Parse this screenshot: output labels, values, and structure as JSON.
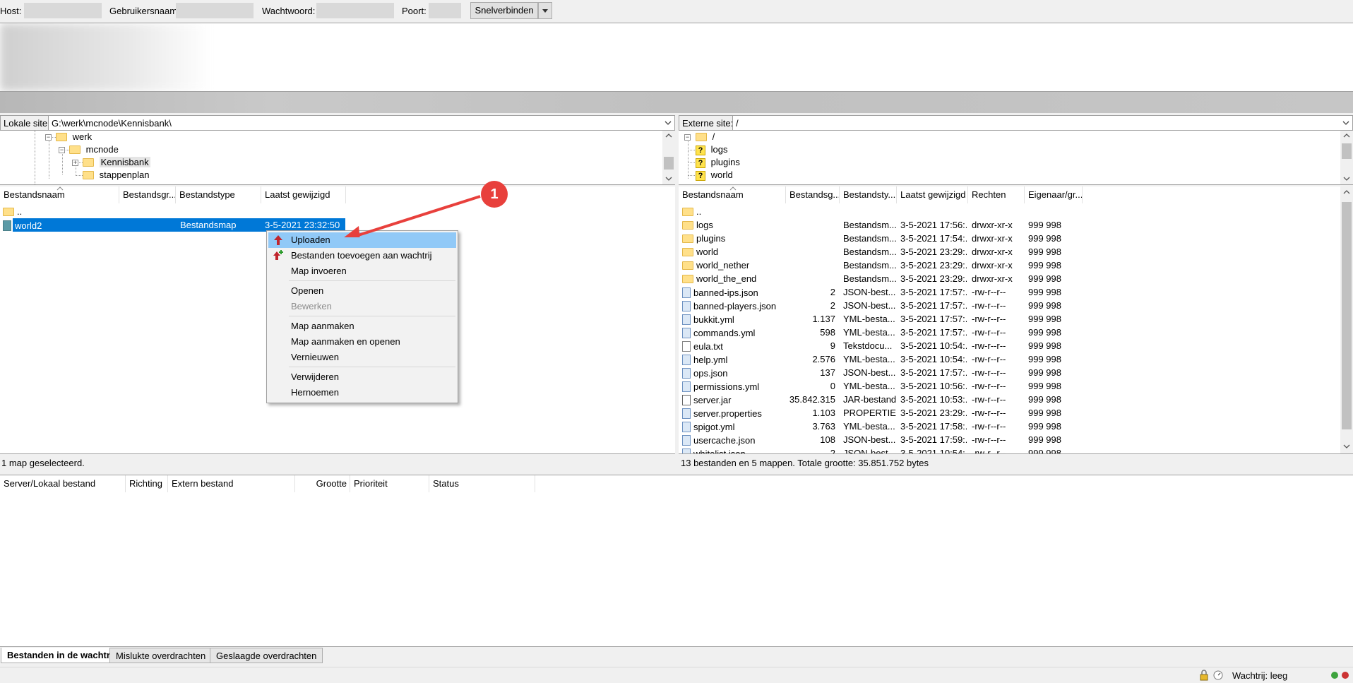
{
  "quickconnect": {
    "host_label": "Host:",
    "user_label": "Gebruikersnaam:",
    "pass_label": "Wachtwoord:",
    "port_label": "Poort:",
    "connect_button": "Snelverbinden",
    "dropdown_icon": "chevron-down-icon"
  },
  "local": {
    "site_label": "Lokale site:",
    "path": "G:\\werk\\mcnode\\Kennisbank\\",
    "tree": [
      "werk",
      "mcnode",
      "Kennisbank",
      "stappenplan"
    ],
    "columns": [
      "Bestandsnaam",
      "Bestandsgr...",
      "Bestandstype",
      "Laatst gewijzigd"
    ],
    "files": [
      {
        "name": "..",
        "type": "",
        "modified": ""
      },
      {
        "name": "world2",
        "type": "Bestandsmap",
        "modified": "3-5-2021 23:32:50"
      }
    ],
    "status": "1 map geselecteerd."
  },
  "remote": {
    "site_label": "Externe site:",
    "path": "/",
    "tree": [
      "/",
      "logs",
      "plugins",
      "world"
    ],
    "tree_badge": "?",
    "columns": [
      "Bestandsnaam",
      "Bestandsg...",
      "Bestandsty...",
      "Laatst gewijzigd",
      "Rechten",
      "Eigenaar/gr..."
    ],
    "files": [
      {
        "name": "..",
        "size": "",
        "type": "",
        "modified": "",
        "perms": "",
        "owner": "",
        "icon": "folder"
      },
      {
        "name": "logs",
        "size": "",
        "type": "Bestandsm...",
        "modified": "3-5-2021 17:56:...",
        "perms": "drwxr-xr-x",
        "owner": "999 998",
        "icon": "folder"
      },
      {
        "name": "plugins",
        "size": "",
        "type": "Bestandsm...",
        "modified": "3-5-2021 17:54:...",
        "perms": "drwxr-xr-x",
        "owner": "999 998",
        "icon": "folder"
      },
      {
        "name": "world",
        "size": "",
        "type": "Bestandsm...",
        "modified": "3-5-2021 23:29:...",
        "perms": "drwxr-xr-x",
        "owner": "999 998",
        "icon": "folder"
      },
      {
        "name": "world_nether",
        "size": "",
        "type": "Bestandsm...",
        "modified": "3-5-2021 23:29:...",
        "perms": "drwxr-xr-x",
        "owner": "999 998",
        "icon": "folder"
      },
      {
        "name": "world_the_end",
        "size": "",
        "type": "Bestandsm...",
        "modified": "3-5-2021 23:29:...",
        "perms": "drwxr-xr-x",
        "owner": "999 998",
        "icon": "folder"
      },
      {
        "name": "banned-ips.json",
        "size": "2",
        "type": "JSON-best...",
        "modified": "3-5-2021 17:57:...",
        "perms": "-rw-r--r--",
        "owner": "999 998",
        "icon": "file"
      },
      {
        "name": "banned-players.json",
        "size": "2",
        "type": "JSON-best...",
        "modified": "3-5-2021 17:57:...",
        "perms": "-rw-r--r--",
        "owner": "999 998",
        "icon": "file"
      },
      {
        "name": "bukkit.yml",
        "size": "1.137",
        "type": "YML-besta...",
        "modified": "3-5-2021 17:57:...",
        "perms": "-rw-r--r--",
        "owner": "999 998",
        "icon": "file"
      },
      {
        "name": "commands.yml",
        "size": "598",
        "type": "YML-besta...",
        "modified": "3-5-2021 17:57:...",
        "perms": "-rw-r--r--",
        "owner": "999 998",
        "icon": "file"
      },
      {
        "name": "eula.txt",
        "size": "9",
        "type": "Tekstdocu...",
        "modified": "3-5-2021 10:54:...",
        "perms": "-rw-r--r--",
        "owner": "999 998",
        "icon": "text"
      },
      {
        "name": "help.yml",
        "size": "2.576",
        "type": "YML-besta...",
        "modified": "3-5-2021 10:54:...",
        "perms": "-rw-r--r--",
        "owner": "999 998",
        "icon": "file"
      },
      {
        "name": "ops.json",
        "size": "137",
        "type": "JSON-best...",
        "modified": "3-5-2021 17:57:...",
        "perms": "-rw-r--r--",
        "owner": "999 998",
        "icon": "file"
      },
      {
        "name": "permissions.yml",
        "size": "0",
        "type": "YML-besta...",
        "modified": "3-5-2021 10:56:...",
        "perms": "-rw-r--r--",
        "owner": "999 998",
        "icon": "file"
      },
      {
        "name": "server.jar",
        "size": "35.842.315",
        "type": "JAR-bestand",
        "modified": "3-5-2021 10:53:...",
        "perms": "-rw-r--r--",
        "owner": "999 998",
        "icon": "jar"
      },
      {
        "name": "server.properties",
        "size": "1.103",
        "type": "PROPERTIE...",
        "modified": "3-5-2021 23:29:...",
        "perms": "-rw-r--r--",
        "owner": "999 998",
        "icon": "file"
      },
      {
        "name": "spigot.yml",
        "size": "3.763",
        "type": "YML-besta...",
        "modified": "3-5-2021 17:58:...",
        "perms": "-rw-r--r--",
        "owner": "999 998",
        "icon": "file"
      },
      {
        "name": "usercache.json",
        "size": "108",
        "type": "JSON-best...",
        "modified": "3-5-2021 17:59:...",
        "perms": "-rw-r--r--",
        "owner": "999 998",
        "icon": "file"
      },
      {
        "name": "whitelist.json",
        "size": "2",
        "type": "JSON-best...",
        "modified": "3-5-2021 10:54:...",
        "perms": "-rw-r--r--",
        "owner": "999 998",
        "icon": "file"
      }
    ],
    "status": "13 bestanden en 5 mappen. Totale grootte: 35.851.752 bytes"
  },
  "context_menu": {
    "items": [
      {
        "label": "Uploaden",
        "enabled": true,
        "highlighted": true
      },
      {
        "label": "Bestanden toevoegen aan wachtrij",
        "enabled": true
      },
      {
        "label": "Map invoeren",
        "enabled": true
      },
      {
        "label": "Openen",
        "enabled": true
      },
      {
        "label": "Bewerken",
        "enabled": false
      },
      {
        "label": "Map aanmaken",
        "enabled": true
      },
      {
        "label": "Map aanmaken en openen",
        "enabled": true
      },
      {
        "label": "Vernieuwen",
        "enabled": true
      },
      {
        "label": "Verwijderen",
        "enabled": true
      },
      {
        "label": "Hernoemen",
        "enabled": true
      }
    ]
  },
  "annotation": {
    "number": "1",
    "color": "#e8403c"
  },
  "queue": {
    "columns": [
      "Server/Lokaal bestand",
      "Richting",
      "Extern bestand",
      "Grootte",
      "Prioriteit",
      "Status"
    ]
  },
  "tabs": [
    "Bestanden in de wachtrij",
    "Mislukte overdrachten",
    "Geslaagde overdrachten"
  ],
  "statusbar": {
    "queue_text": "Wachtrij: leeg"
  },
  "colors": {
    "selection": "#0078d7",
    "menu_highlight": "#91c9f7",
    "annotation": "#e8403c"
  }
}
